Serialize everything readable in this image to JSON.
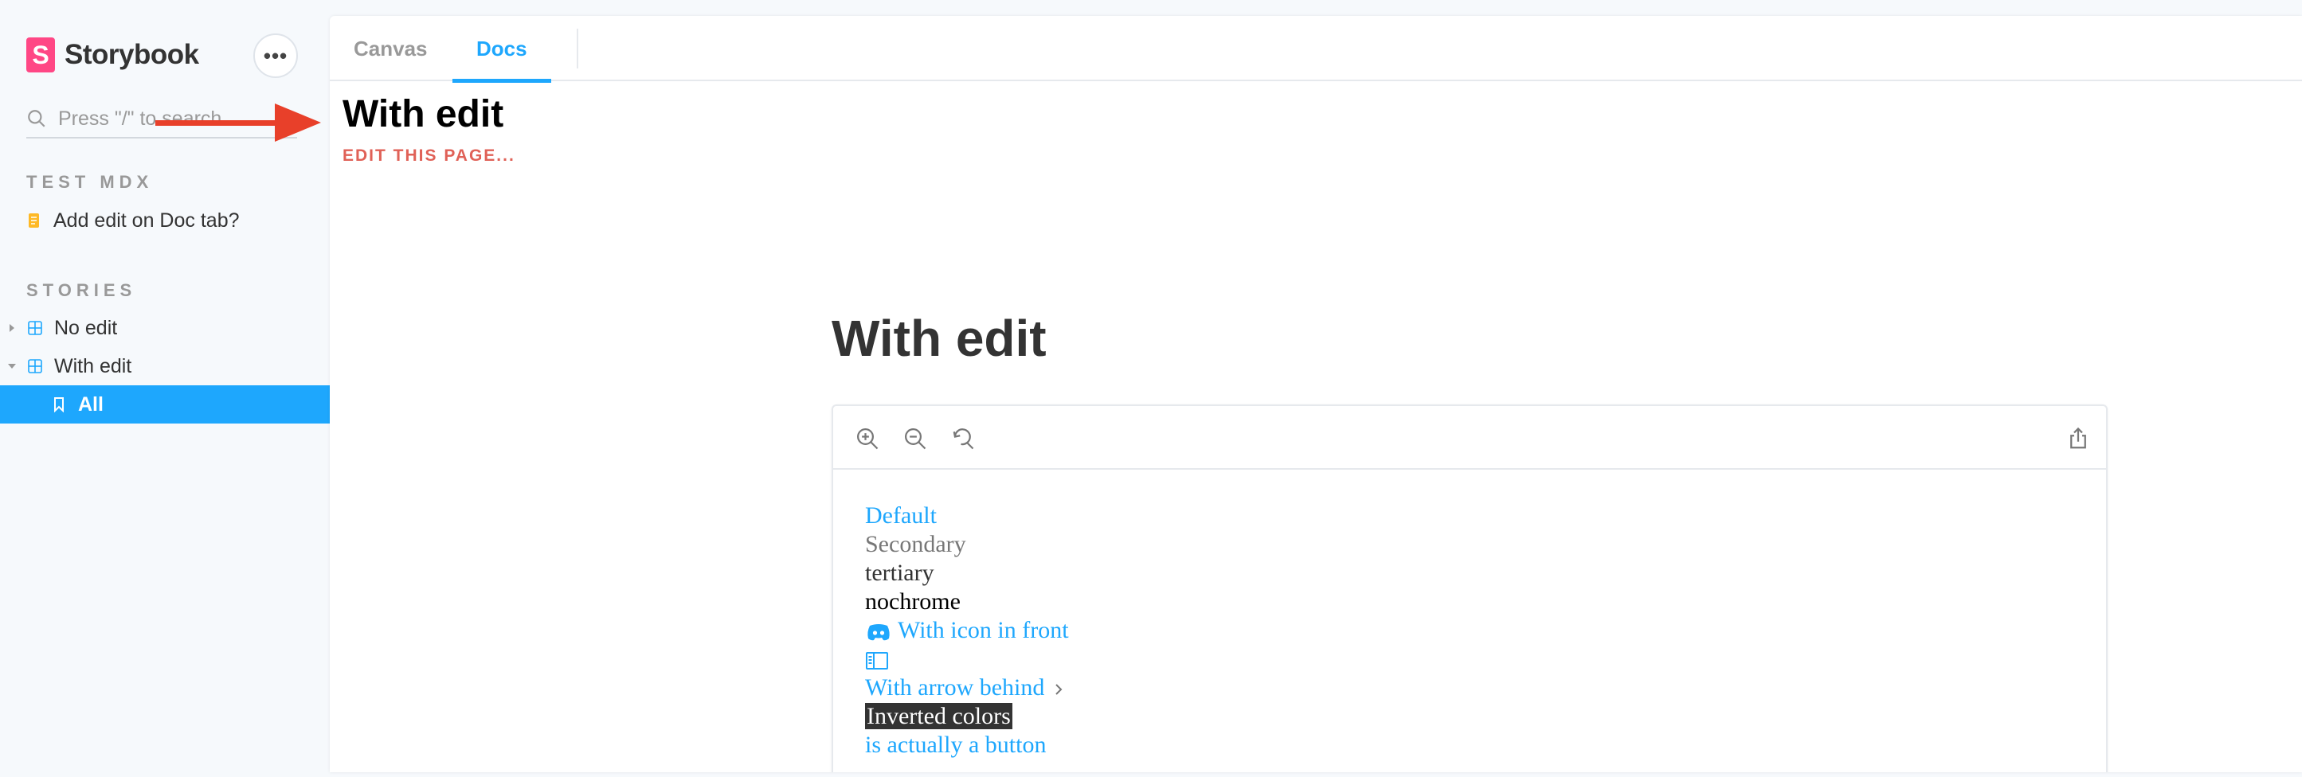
{
  "sidebar": {
    "brand": {
      "logo_letter": "S",
      "name": "Storybook"
    },
    "menu_button": "•••",
    "search": {
      "placeholder": "Press \"/\" to search..."
    },
    "sections": [
      {
        "title": "TEST MDX"
      },
      {
        "title": "STORIES"
      }
    ],
    "items": {
      "add_edit": "Add edit on Doc tab?",
      "no_edit": "No edit",
      "with_edit": "With edit",
      "all": "All"
    }
  },
  "tabs": [
    {
      "label": "Canvas"
    },
    {
      "label": "Docs"
    }
  ],
  "main": {
    "story_title": "With edit",
    "edit_link": "EDIT THIS PAGE...",
    "docs_title": "With edit"
  },
  "preview": {
    "lines": {
      "default": "Default",
      "secondary": "Secondary",
      "tertiary": "tertiary",
      "nochrome": "nochrome",
      "with_icon": "With icon in front",
      "with_arrow": "With arrow behind",
      "inverted": "Inverted colors",
      "button": "is actually a button"
    }
  },
  "colors": {
    "accent": "#1ea7fd",
    "brand": "#ff4785",
    "edit_link": "#e06157",
    "annotation_arrow": "#e8402a"
  }
}
